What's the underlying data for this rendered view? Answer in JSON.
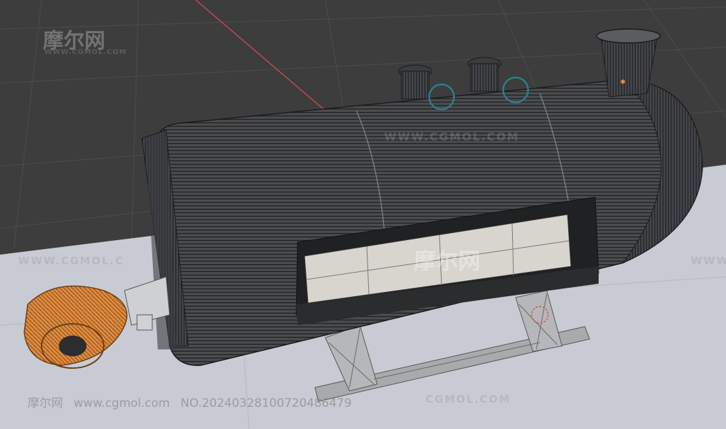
{
  "viewport": {
    "background_color": "#3d3d3d",
    "ground_color": "#c9cbd4",
    "grid_color": "#555555",
    "axis_x_color": "#c0494f",
    "model_wire_color": "#2b2d2f",
    "burner_color": "#e08a3c",
    "frame_color": "#9a9a9a"
  },
  "watermarks": {
    "logo_cn": "摩尔网",
    "logo_sub": "WWW.CGMOL.COM",
    "url_upper": "WWW.CGMOL.COM",
    "url_left": "WWW.CGMOL.C",
    "url_right": "WWW",
    "url_center": "CGMOL.COM"
  },
  "footer": {
    "site_cn": "摩尔网",
    "site_url": "www.cgmol.com",
    "number": "NO.20240328100720486479"
  }
}
